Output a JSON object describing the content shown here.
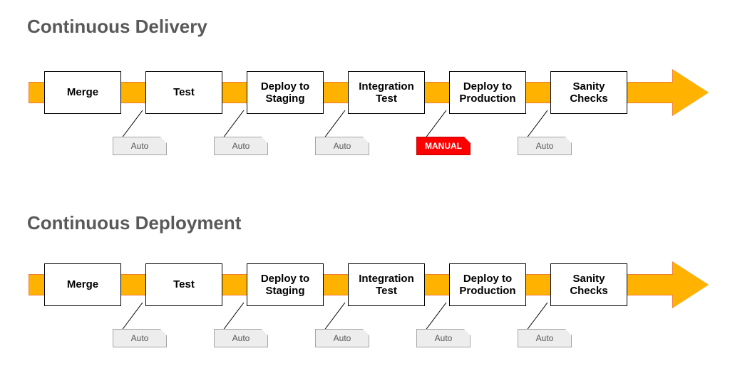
{
  "colors": {
    "arrow_fill": "#FFB200",
    "arrow_stroke": "#ED7D31",
    "manual_fill": "#FF0000",
    "auto_fill": "#EDEDED",
    "title_color": "#595959"
  },
  "sections": {
    "delivery": {
      "title": "Continuous Delivery",
      "stages": [
        {
          "label": "Merge",
          "tag": null
        },
        {
          "label": "Test",
          "tag": "Auto"
        },
        {
          "label": "Deploy to Staging",
          "tag": "Auto"
        },
        {
          "label": "Integration Test",
          "tag": "Auto"
        },
        {
          "label": "Deploy to Production",
          "tag": "MANUAL"
        },
        {
          "label": "Sanity Checks",
          "tag": "Auto"
        }
      ]
    },
    "deployment": {
      "title": "Continuous Deployment",
      "stages": [
        {
          "label": "Merge",
          "tag": null
        },
        {
          "label": "Test",
          "tag": "Auto"
        },
        {
          "label": "Deploy to Staging",
          "tag": "Auto"
        },
        {
          "label": "Integration Test",
          "tag": "Auto"
        },
        {
          "label": "Deploy to Production",
          "tag": "Auto"
        },
        {
          "label": "Sanity Checks",
          "tag": "Auto"
        }
      ]
    }
  }
}
